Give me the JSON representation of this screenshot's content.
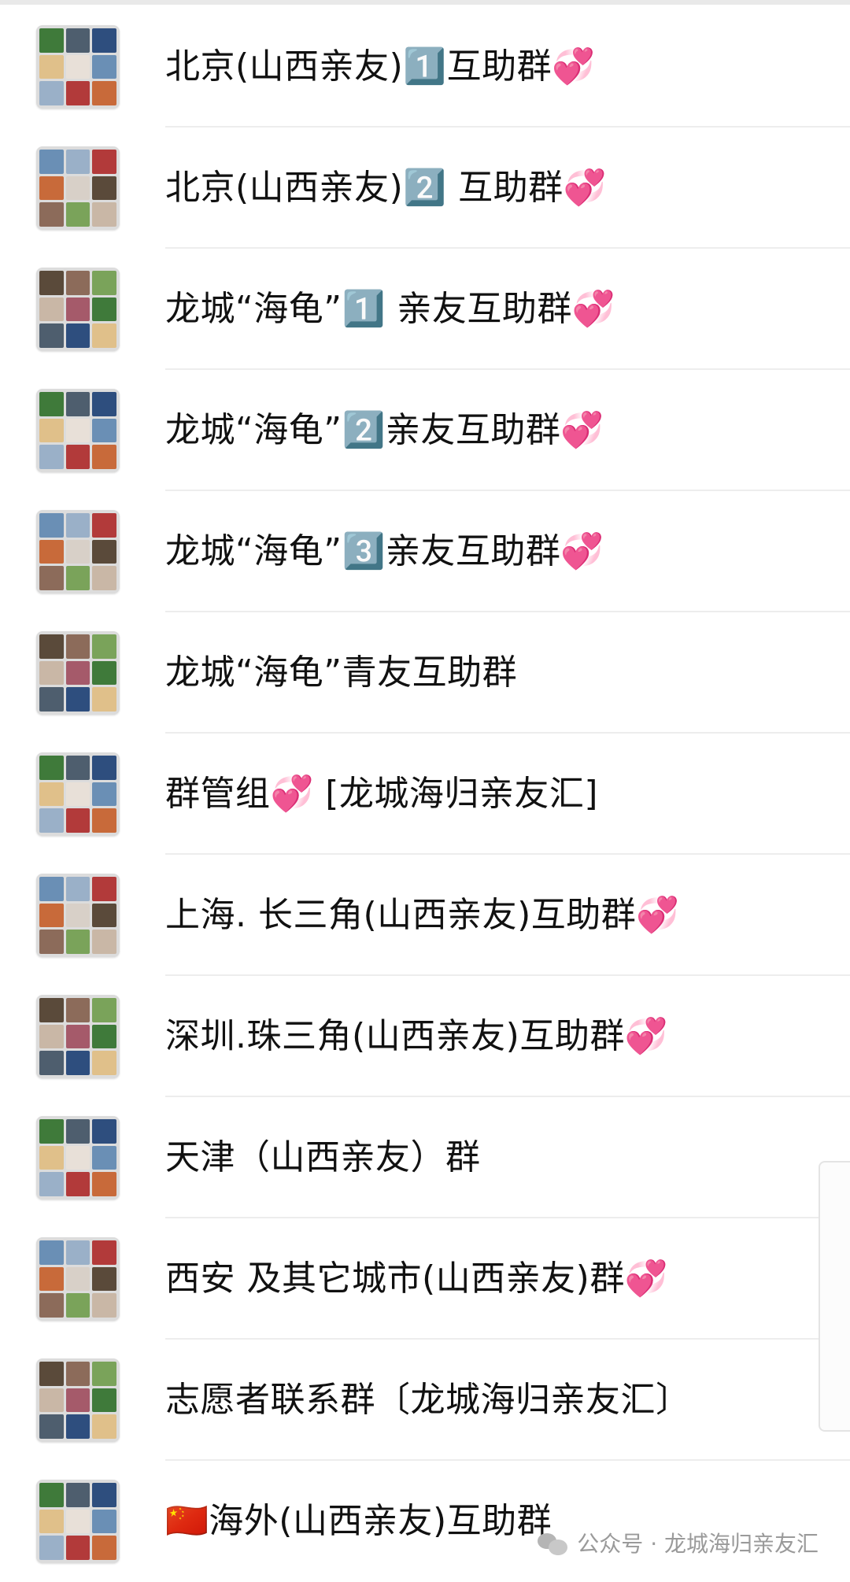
{
  "groups": [
    {
      "name": "北京(山西亲友)1️⃣互助群💞"
    },
    {
      "name": "北京(山西亲友)2️⃣ 互助群💞"
    },
    {
      "name": "龙城“海龟”1️⃣ 亲友互助群💞"
    },
    {
      "name": "龙城“海龟”2️⃣亲友互助群💞"
    },
    {
      "name": "龙城“海龟”3️⃣亲友互助群💞"
    },
    {
      "name": "龙城“海龟”青友互助群"
    },
    {
      "name": "群管组💞 [龙城海归亲友汇]"
    },
    {
      "name": "上海. 长三角(山西亲友)互助群💞"
    },
    {
      "name": "深圳.珠三角(山西亲友)互助群💞"
    },
    {
      "name": "天津（山西亲友）群"
    },
    {
      "name": "西安 及其它城市(山西亲友)群💞"
    },
    {
      "name": "志愿者联系群〔龙城海归亲友汇〕"
    },
    {
      "name": "🇨🇳海外(山西亲友)互助群"
    }
  ],
  "watermark": {
    "text": "公众号 · 龙城海归亲友汇",
    "icon": "wechat-icon"
  },
  "colors": {
    "background": "#ffffff",
    "divider": "#ededed",
    "text": "#111111",
    "watermark": "#9a9a9a"
  }
}
